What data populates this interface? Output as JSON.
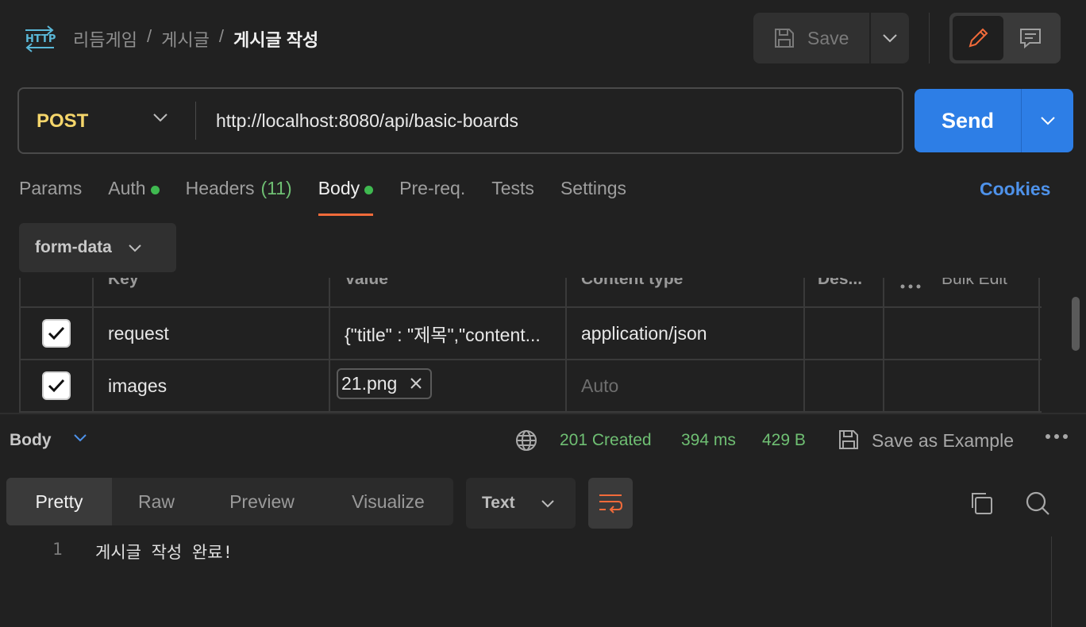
{
  "breadcrumb": {
    "parts": [
      "리듬게임",
      "게시글"
    ],
    "separator": "/",
    "current": "게시글 작성"
  },
  "toolbar": {
    "save_label": "Save"
  },
  "request": {
    "method": "POST",
    "url": "http://localhost:8080/api/basic-boards",
    "send_label": "Send"
  },
  "tabs": {
    "params": "Params",
    "auth": "Auth",
    "headers": "Headers",
    "headers_count": "(11)",
    "body": "Body",
    "prereq": "Pre-req.",
    "tests": "Tests",
    "settings": "Settings",
    "cookies": "Cookies"
  },
  "body_type": "form-data",
  "table": {
    "headers": {
      "key": "Key",
      "value": "Value",
      "content_type": "Content type",
      "description": "Des...",
      "bulk_edit": "Bulk Edit"
    },
    "rows": [
      {
        "checked": true,
        "key": "request",
        "value": "{\"title\" : \"제목\",\"content...",
        "content_type": "application/json"
      },
      {
        "checked": true,
        "key": "images",
        "value": "21.png",
        "content_type_placeholder": "Auto"
      }
    ]
  },
  "response": {
    "label": "Body",
    "status": "201 Created",
    "time": "394 ms",
    "size": "429 B",
    "save_example": "Save as Example",
    "view_tabs": [
      "Pretty",
      "Raw",
      "Preview",
      "Visualize"
    ],
    "format": "Text",
    "lines": [
      {
        "no": "1",
        "text": "게시글 작성 완료!"
      }
    ]
  },
  "colors": {
    "accent": "#f26b3a",
    "send": "#2d7ee6",
    "method": "#f5d66b",
    "status_ok": "#6fbf73",
    "link": "#4e92ea"
  }
}
